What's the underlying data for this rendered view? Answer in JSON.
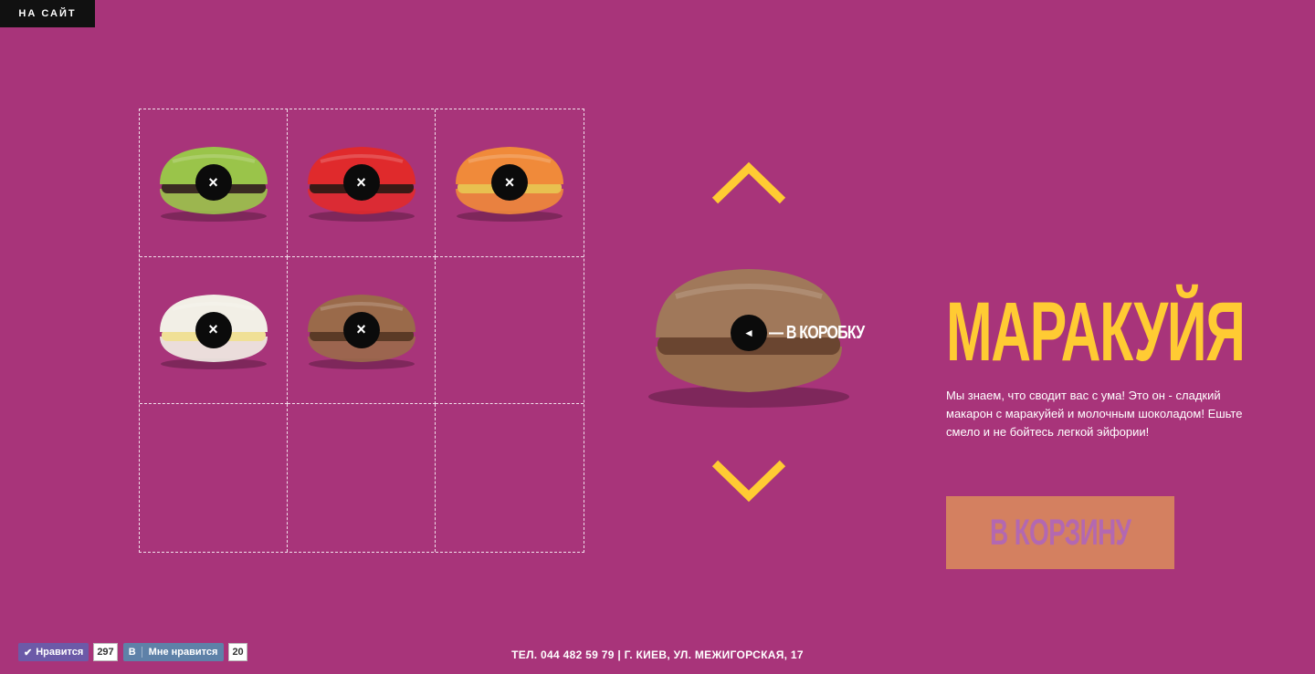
{
  "nav": {
    "site_label": "НА САЙТ"
  },
  "box": {
    "slots": [
      {
        "flavor_color": "#9ac44a",
        "filling": "#3a2a22"
      },
      {
        "flavor_color": "#e02a2c",
        "filling": "#3a1a16"
      },
      {
        "flavor_color": "#f08a3a",
        "filling": "#e8c050"
      },
      {
        "flavor_color": "#f2efe6",
        "filling": "#f0e096"
      },
      {
        "flavor_color": "#9a6a4a",
        "filling": "#5a3a26"
      },
      null,
      null,
      null,
      null
    ],
    "remove_icon": "×"
  },
  "carousel": {
    "current_color": "#a0785a",
    "to_box_label": "— В КОРОБКУ",
    "to_box_icon": "◄"
  },
  "product": {
    "name": "МАРАКУЙЯ",
    "description": "Мы знаем, что сводит вас с ума! Это он - сладкий макарон с маракуйей и молочным шоколадом! Ешьте смело и не бойтесь легкой эйфории!",
    "cart_label": "В КОРЗИНУ"
  },
  "social": {
    "fb_label": "Нравится",
    "fb_count": "297",
    "vk_logo": "В",
    "vk_label": "Мне нравится",
    "vk_count": "20"
  },
  "footer": {
    "contact": "ТЕЛ. 044 482 59 79 | Г. КИЕВ, УЛ. МЕЖИГОРСКАЯ, 17"
  },
  "colors": {
    "background": "#a8347a",
    "accent": "#ffcb33",
    "cart_bg": "#d48060"
  }
}
